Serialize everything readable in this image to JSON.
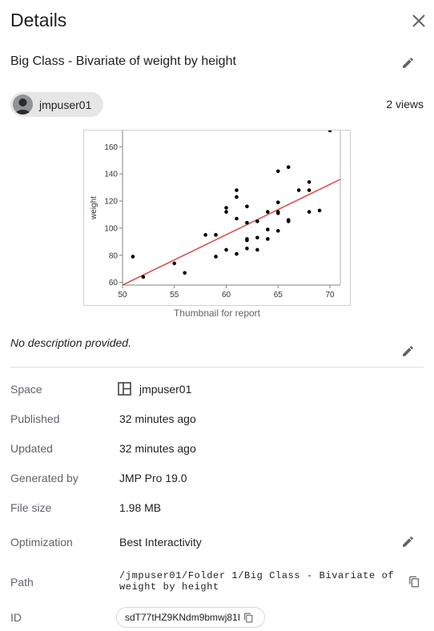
{
  "header": {
    "title": "Details"
  },
  "report": {
    "title": "Big Class - Bivariate of weight by height"
  },
  "owner": {
    "name": "jmpuser01"
  },
  "stats": {
    "views": "2 views"
  },
  "thumbnail": {
    "caption": "Thumbnail for report"
  },
  "description": {
    "text": "No description provided."
  },
  "details": {
    "space_label": "Space",
    "space_value": "jmpuser01",
    "published_label": "Published",
    "published_value": "32 minutes ago",
    "updated_label": "Updated",
    "updated_value": "32 minutes ago",
    "generated_label": "Generated by",
    "generated_value": "JMP Pro 19.0",
    "filesize_label": "File size",
    "filesize_value": "1.98 MB",
    "optimization_label": "Optimization",
    "optimization_value": "Best Interactivity",
    "path_label": "Path",
    "path_line1": "/jmpuser01/Folder 1/Big Class - Bivariate of",
    "path_line2": "weight by height",
    "id_label": "ID",
    "id_value": "sdT77tHZ9KNdm9bmwj81I"
  },
  "colors": {
    "fit_line": "#d9534f",
    "points": "#000000",
    "text_secondary": "#5f6368"
  },
  "chart_data": {
    "type": "scatter",
    "title": "",
    "xlabel": "",
    "ylabel": "weight",
    "xlim": [
      50,
      71
    ],
    "ylim": [
      58,
      172
    ],
    "x_ticks": [
      50,
      55,
      60,
      65,
      70
    ],
    "y_ticks": [
      60,
      80,
      100,
      120,
      140,
      160
    ],
    "points": [
      [
        51,
        79
      ],
      [
        52,
        64
      ],
      [
        55,
        74
      ],
      [
        56,
        67
      ],
      [
        58,
        95
      ],
      [
        59,
        95
      ],
      [
        59,
        79
      ],
      [
        60,
        115
      ],
      [
        60,
        112
      ],
      [
        60,
        84
      ],
      [
        61,
        128
      ],
      [
        61,
        123
      ],
      [
        61,
        107
      ],
      [
        61,
        81
      ],
      [
        62,
        116
      ],
      [
        62,
        104
      ],
      [
        62,
        92
      ],
      [
        62,
        91
      ],
      [
        62,
        85
      ],
      [
        63,
        105
      ],
      [
        63,
        93
      ],
      [
        63,
        84
      ],
      [
        64,
        112
      ],
      [
        64,
        99
      ],
      [
        64,
        92
      ],
      [
        65,
        142
      ],
      [
        65,
        119
      ],
      [
        65,
        112
      ],
      [
        65,
        111
      ],
      [
        65,
        98
      ],
      [
        66,
        145
      ],
      [
        66,
        106
      ],
      [
        66,
        105
      ],
      [
        67,
        128
      ],
      [
        68,
        134
      ],
      [
        68,
        128
      ],
      [
        68,
        112
      ],
      [
        69,
        113
      ],
      [
        70,
        172
      ]
    ],
    "fit_line": [
      [
        50,
        58
      ],
      [
        71,
        136
      ]
    ],
    "grid": false,
    "legend": "none"
  }
}
